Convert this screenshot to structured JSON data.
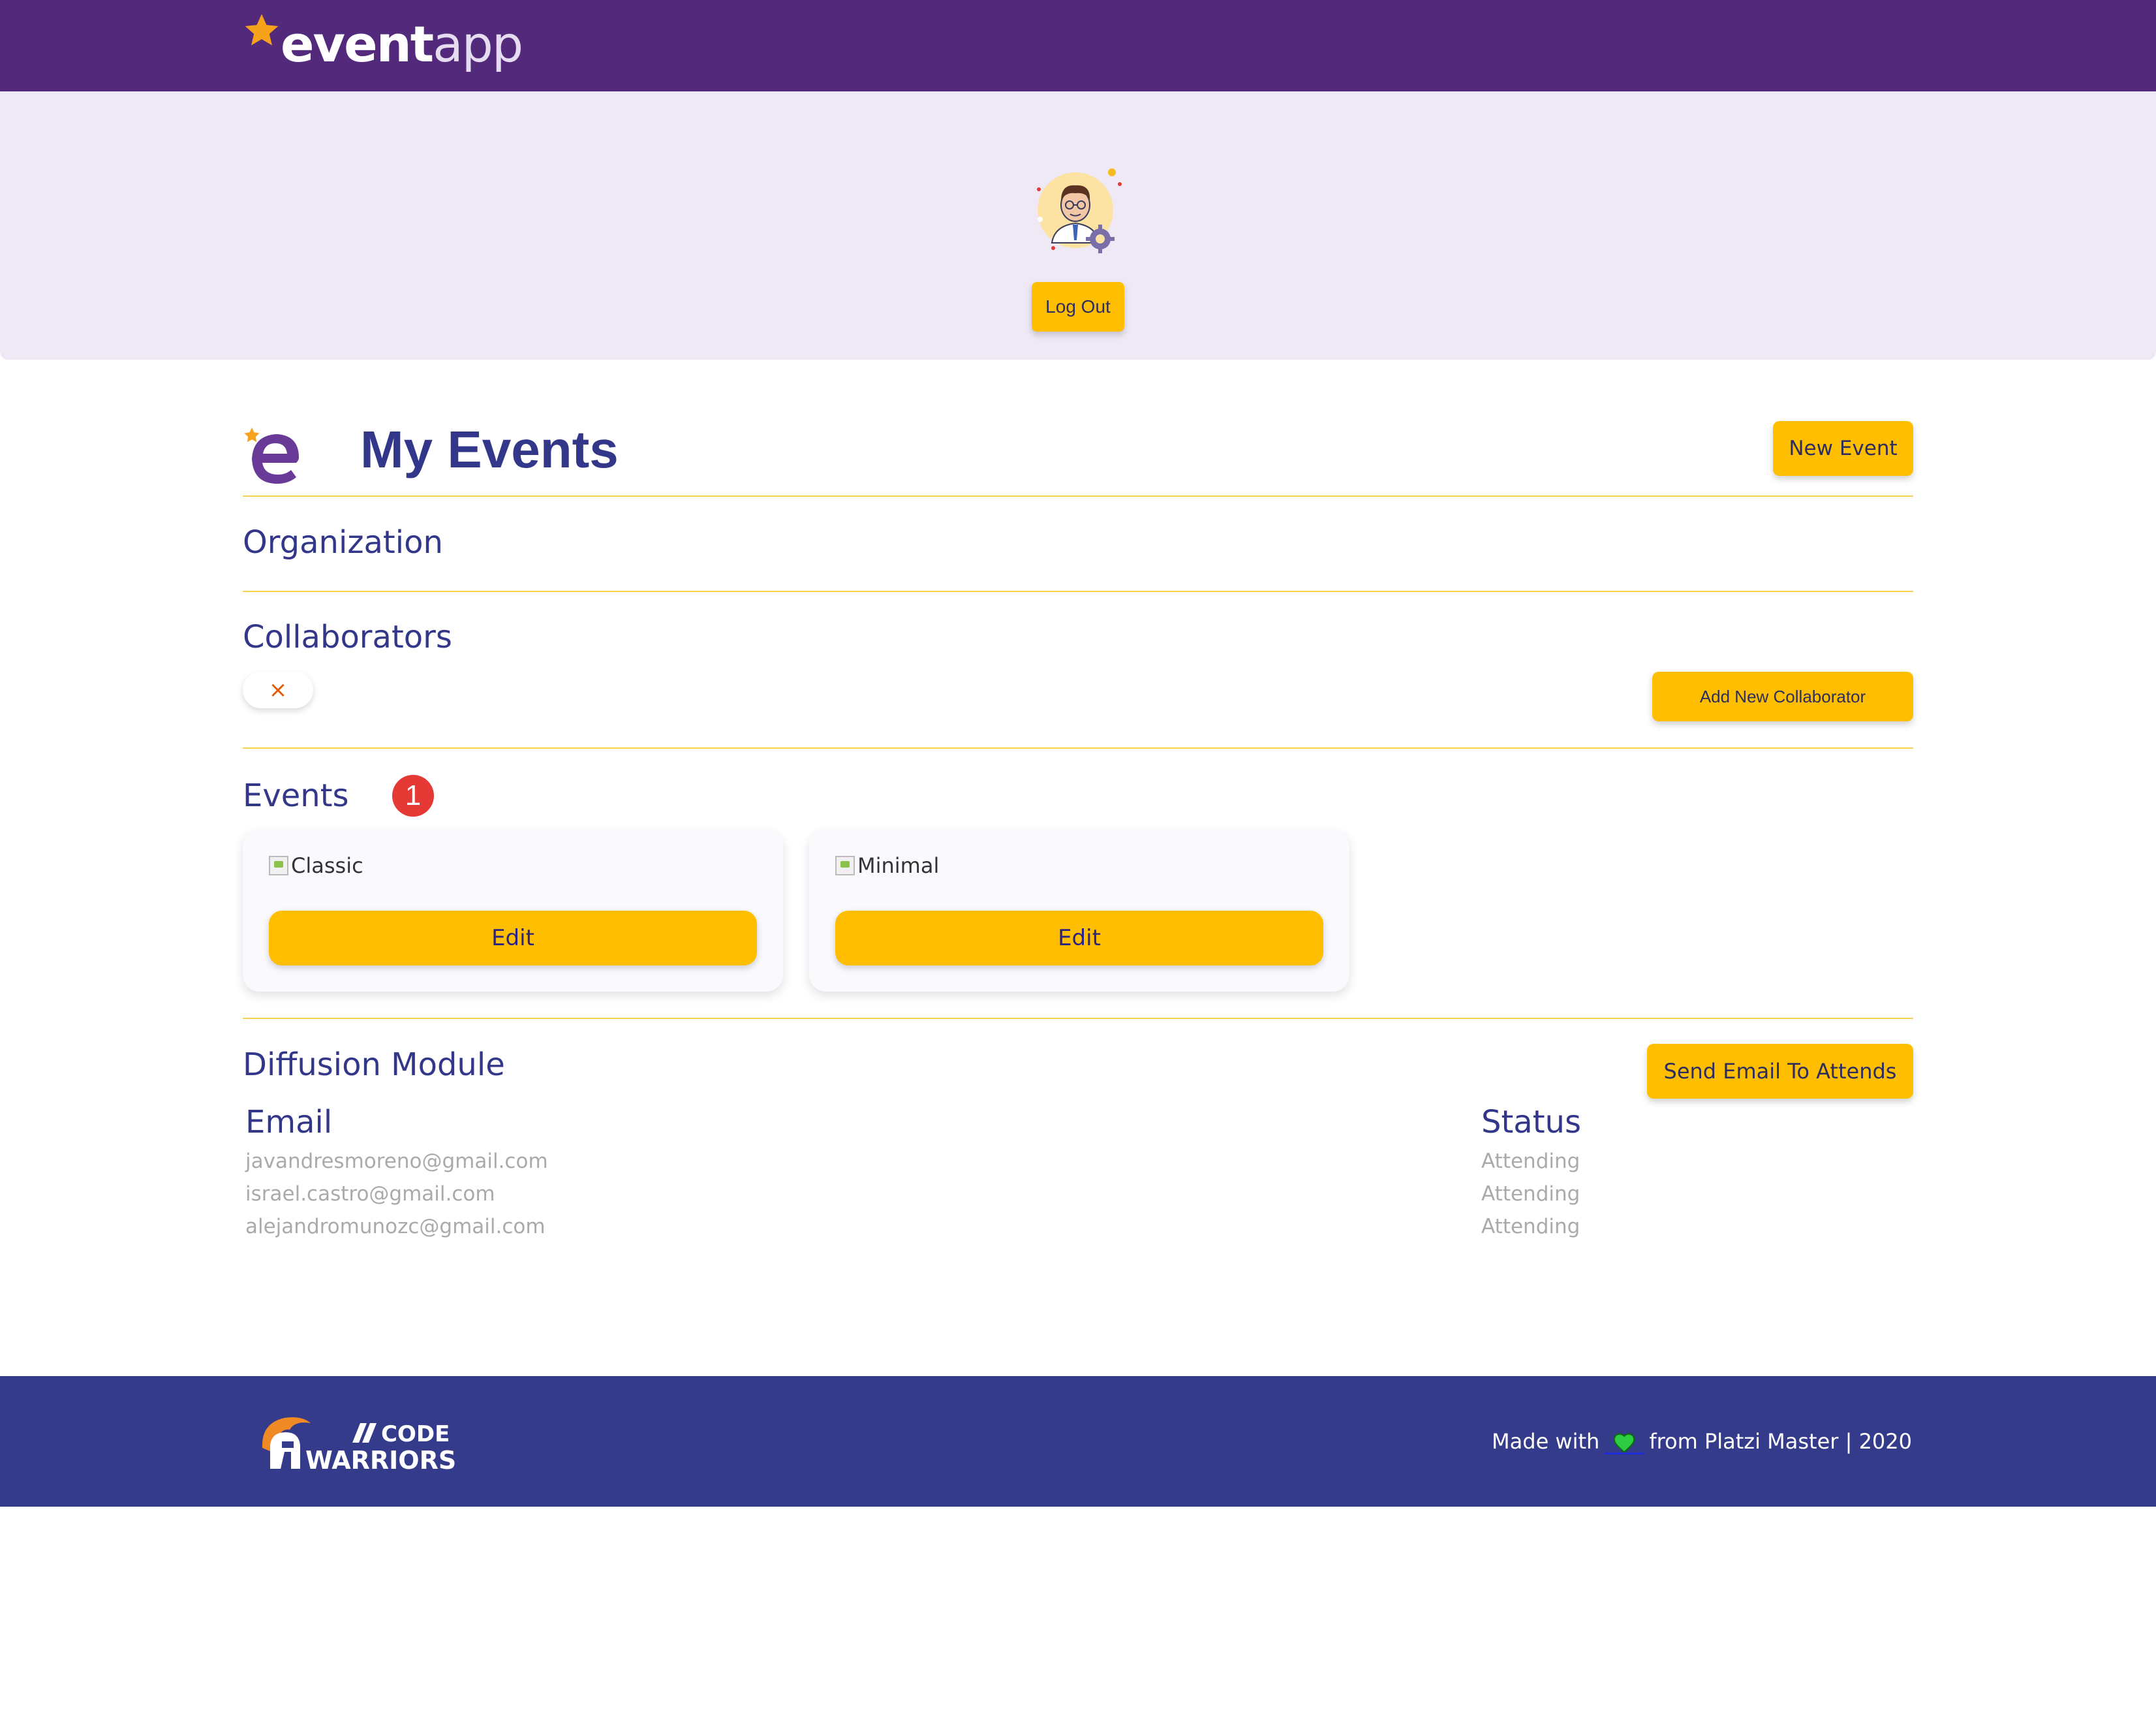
{
  "header": {
    "logo_bold": "event",
    "logo_light": "app"
  },
  "profile": {
    "avatar_icon": "user-avatar-with-gear",
    "logout_label": "Log Out"
  },
  "page": {
    "title": "My Events",
    "new_event_label": "New Event"
  },
  "sections": {
    "organization": "Organization",
    "collaborators": "Collaborators",
    "collaborator_chip_remove": "×",
    "add_collaborator_label": "Add New Collaborator",
    "events": "Events",
    "events_badge": "1",
    "diffusion": "Diffusion Module",
    "send_email_label": "Send Email To Attends"
  },
  "events": [
    {
      "image_alt": "Classic",
      "edit_label": "Edit"
    },
    {
      "image_alt": "Minimal",
      "edit_label": "Edit"
    }
  ],
  "attendees": {
    "email_header": "Email",
    "status_header": "Status",
    "rows": [
      {
        "email": "javandresmoreno@gmail.com",
        "status": "Attending"
      },
      {
        "email": "israel.castro@gmail.com",
        "status": "Attending"
      },
      {
        "email": "alejandromunozc@gmail.com",
        "status": "Attending"
      }
    ]
  },
  "footer": {
    "logo_line1": "CODE",
    "logo_line2": "WARRIORS",
    "made_with": "Made with",
    "from": "from Platzi Master | 2020"
  },
  "colors": {
    "header_purple": "#53297b",
    "profile_band": "#eee9f5",
    "accent_yellow": "#ffbf00",
    "title_blue": "#33378a",
    "footer_blue": "#353b8b",
    "badge_red": "#e53935"
  }
}
